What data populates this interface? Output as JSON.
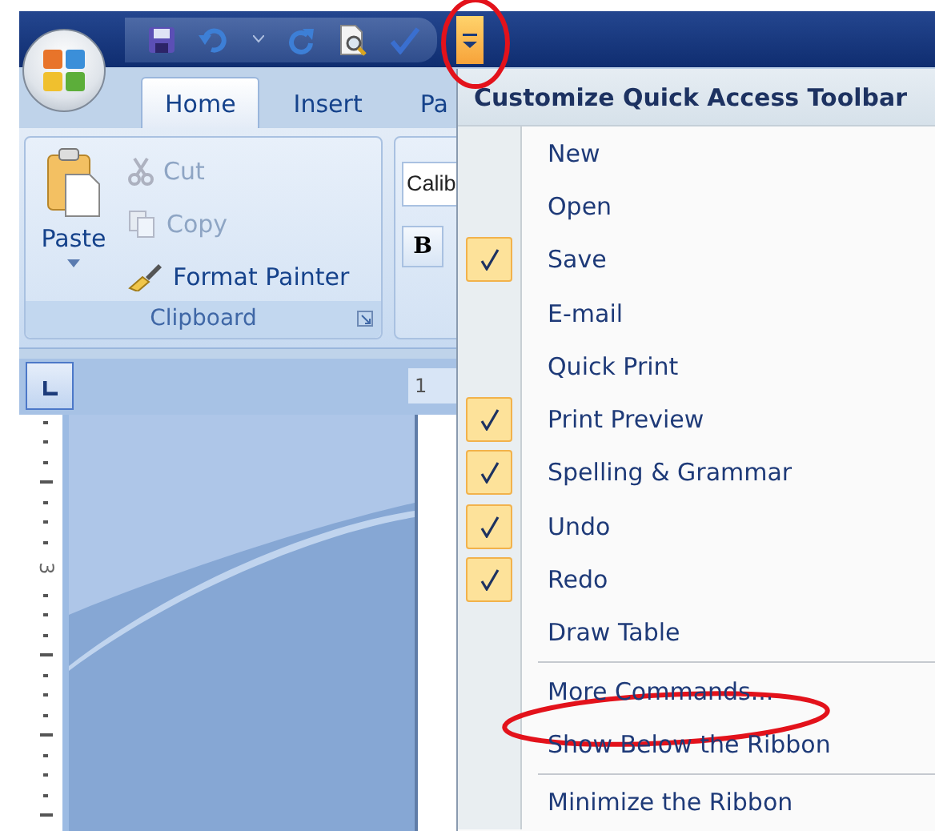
{
  "quick_access_toolbar": {
    "customize_button": {
      "expanded": true
    }
  },
  "tabs": [
    {
      "label": "Home",
      "selected": true
    },
    {
      "label": "Insert",
      "selected": false
    },
    {
      "label": "Pa",
      "selected": false
    }
  ],
  "clipboard_group": {
    "title": "Clipboard",
    "paste": "Paste",
    "commands": [
      {
        "kind": "cut",
        "label": "Cut",
        "disabled": true
      },
      {
        "kind": "copy",
        "label": "Copy",
        "disabled": true
      },
      {
        "kind": "format-painter",
        "label": "Format Painter",
        "disabled": false
      }
    ]
  },
  "font_group": {
    "font_name": "Calib",
    "bold": "B"
  },
  "rulers": {
    "horizontal_label": "1",
    "vertical_label": "3"
  },
  "menu": {
    "title": "Customize Quick Access Toolbar",
    "sections": [
      {
        "items": [
          {
            "label": "New",
            "checked": false
          },
          {
            "label": "Open",
            "checked": false
          },
          {
            "label": "Save",
            "checked": true
          },
          {
            "label": "E-mail",
            "checked": false
          },
          {
            "label": "Quick Print",
            "checked": false
          },
          {
            "label": "Print Preview",
            "checked": true
          },
          {
            "label": "Spelling & Grammar",
            "checked": true
          },
          {
            "label": "Undo",
            "checked": true
          },
          {
            "label": "Redo",
            "checked": true
          },
          {
            "label": "Draw Table",
            "checked": false
          }
        ]
      },
      {
        "items": [
          {
            "label": "More Commands..."
          },
          {
            "label": "Show Below the Ribbon"
          }
        ]
      },
      {
        "items": [
          {
            "label": "Minimize the Ribbon"
          }
        ]
      }
    ]
  },
  "annotations": [
    {
      "kind": "ellipse"
    },
    {
      "kind": "ellipse"
    }
  ]
}
